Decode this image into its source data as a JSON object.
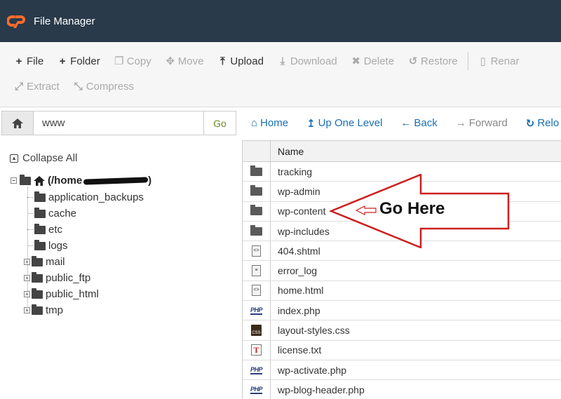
{
  "header": {
    "app_title": "File Manager"
  },
  "toolbar": {
    "row1": [
      {
        "label": "File",
        "icon": "plus-icon",
        "glyph": "+",
        "disabled": false
      },
      {
        "label": "Folder",
        "icon": "plus-icon",
        "glyph": "+",
        "disabled": false
      },
      {
        "label": "Copy",
        "icon": "copy-icon",
        "glyph": "❐",
        "disabled": true
      },
      {
        "label": "Move",
        "icon": "move-icon",
        "glyph": "✥",
        "disabled": true
      },
      {
        "label": "Upload",
        "icon": "upload-icon",
        "glyph": "⤒",
        "disabled": false
      },
      {
        "label": "Download",
        "icon": "download-icon",
        "glyph": "⤓",
        "disabled": true
      },
      {
        "label": "Delete",
        "icon": "delete-icon",
        "glyph": "✖",
        "disabled": true
      },
      {
        "label": "Restore",
        "icon": "restore-icon",
        "glyph": "↺",
        "disabled": true
      },
      {
        "label": "Renar",
        "icon": "file-icon",
        "glyph": "▯",
        "disabled": true
      }
    ],
    "row2": [
      {
        "label": "Extract",
        "icon": "extract-icon",
        "glyph": "⤢",
        "disabled": true
      },
      {
        "label": "Compress",
        "icon": "compress-icon",
        "glyph": "⤡",
        "disabled": true
      }
    ]
  },
  "pathbar": {
    "value": "www",
    "go_label": "Go"
  },
  "nav": [
    {
      "label": "Home",
      "icon": "home-icon",
      "glyph": "⌂",
      "disabled": false
    },
    {
      "label": "Up One Level",
      "icon": "up-arrow-icon",
      "glyph": "↥",
      "disabled": false
    },
    {
      "label": "Back",
      "icon": "back-arrow-icon",
      "glyph": "←",
      "disabled": false
    },
    {
      "label": "Forward",
      "icon": "forward-arrow-icon",
      "glyph": "→",
      "disabled": true
    },
    {
      "label": "Relo",
      "icon": "reload-icon",
      "glyph": "↻",
      "disabled": false
    }
  ],
  "tree": {
    "collapse_label": "Collapse All",
    "root_label": "(/home",
    "root_suffix": ")",
    "items": [
      {
        "label": "application_backups",
        "expandable": false
      },
      {
        "label": "cache",
        "expandable": false
      },
      {
        "label": "etc",
        "expandable": false
      },
      {
        "label": "logs",
        "expandable": false
      },
      {
        "label": "mail",
        "expandable": true
      },
      {
        "label": "public_ftp",
        "expandable": true
      },
      {
        "label": "public_html",
        "expandable": true
      },
      {
        "label": "tmp",
        "expandable": true
      }
    ]
  },
  "table": {
    "name_header": "Name",
    "rows": [
      {
        "name": "tracking",
        "type": "folder"
      },
      {
        "name": "wp-admin",
        "type": "folder"
      },
      {
        "name": "wp-content",
        "type": "folder"
      },
      {
        "name": "wp-includes",
        "type": "folder"
      },
      {
        "name": "404.shtml",
        "type": "html"
      },
      {
        "name": "error_log",
        "type": "doc"
      },
      {
        "name": "home.html",
        "type": "html"
      },
      {
        "name": "index.php",
        "type": "php"
      },
      {
        "name": "layout-styles.css",
        "type": "css"
      },
      {
        "name": "license.txt",
        "type": "txt"
      },
      {
        "name": "wp-activate.php",
        "type": "php"
      },
      {
        "name": "wp-blog-header.php",
        "type": "php"
      }
    ]
  },
  "annotation": {
    "text": "Go Here",
    "color": "#cc1f1f"
  }
}
